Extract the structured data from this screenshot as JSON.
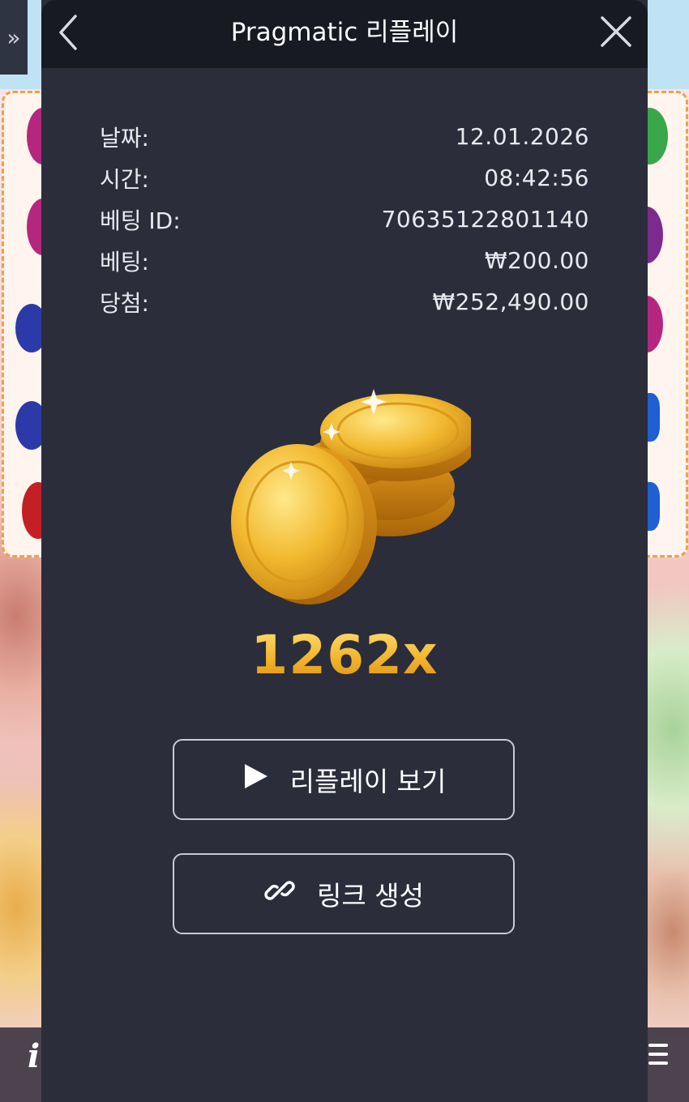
{
  "header": {
    "title": "Pragmatic 리플레이"
  },
  "info": [
    {
      "label": "날짜:",
      "value": "12.01.2026"
    },
    {
      "label": "시간:",
      "value": "08:42:56"
    },
    {
      "label": "베팅 ID:",
      "value": "70635122801140"
    },
    {
      "label": "베팅:",
      "value": "₩200.00"
    },
    {
      "label": "당첨:",
      "value": "₩252,490.00"
    }
  ],
  "multiplier": "1262x",
  "buttons": {
    "replay": "리플레이 보기",
    "link": "링크 생성"
  },
  "icons": {
    "back": "chevron-left-icon",
    "close": "close-icon",
    "play": "play-icon",
    "link": "link-icon",
    "coins": "gold-coins-icon"
  },
  "colors": {
    "modal_bg": "#2b2d3b",
    "header_bg": "#171923",
    "gold": "#f3b52c"
  }
}
